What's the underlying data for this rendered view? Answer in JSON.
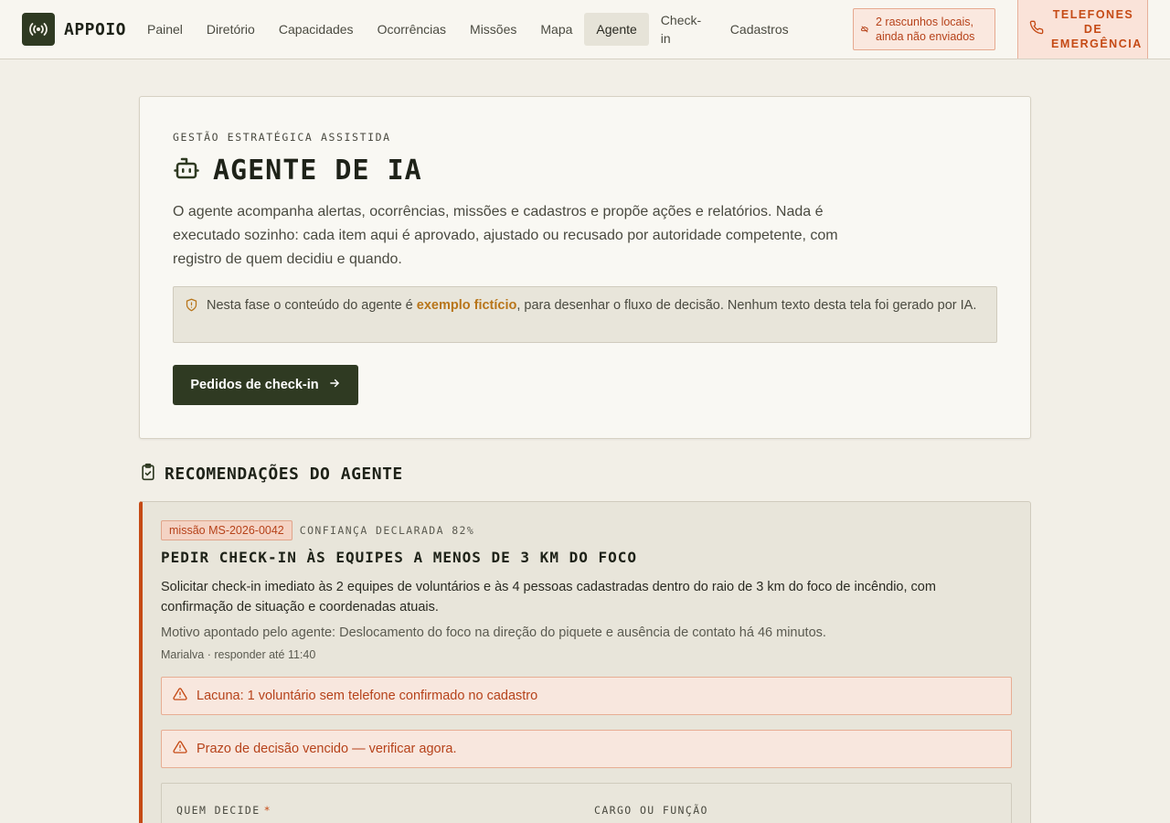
{
  "app": {
    "name": "APPOIO"
  },
  "nav": {
    "items": [
      {
        "label": "Painel"
      },
      {
        "label": "Diretório"
      },
      {
        "label": "Capacidades"
      },
      {
        "label": "Ocorrências"
      },
      {
        "label": "Missões"
      },
      {
        "label": "Mapa"
      },
      {
        "label": "Agente",
        "active": true
      },
      {
        "label": "Check-in"
      },
      {
        "label": "Cadastros"
      }
    ]
  },
  "drafts": {
    "label": "2 rascunhos locais, ainda não enviados"
  },
  "emergency": {
    "label": "TELEFONES DE EMERGÊNCIA"
  },
  "hero": {
    "eyebrow": "GESTÃO ESTRATÉGICA ASSISTIDA",
    "title": "AGENTE DE IA",
    "description": "O agente acompanha alertas, ocorrências, missões e cadastros e propõe ações e relatórios. Nada é executado sozinho: cada item aqui é aprovado, ajustado ou recusado por autoridade competente, com registro de quem decidiu e quando.",
    "notice_before": "Nesta fase o conteúdo do agente é ",
    "notice_highlight": "exemplo fictício",
    "notice_after": ", para desenhar o fluxo de decisão. Nenhum texto desta tela foi gerado por IA.",
    "primary_button": "Pedidos de check-in"
  },
  "recommendations": {
    "title": "RECOMENDAÇÕES DO AGENTE",
    "items": [
      {
        "badge": "missão MS-2026-0042",
        "confidence": "CONFIANÇA DECLARADA 82%",
        "title": "PEDIR CHECK-IN ÀS EQUIPES A MENOS DE 3 KM DO FOCO",
        "description": "Solicitar check-in imediato às 2 equipes de voluntários e às 4 pessoas cadastradas dentro do raio de 3 km do foco de incêndio, com confirmação de situação e coordenadas atuais.",
        "reason": "Motivo apontado pelo agente: Deslocamento do foco na direção do piquete e ausência de contato há 46 minutos.",
        "owner": "Marialva · responder até 11:40",
        "alerts": [
          "Lacuna: 1 voluntário sem telefone confirmado no cadastro",
          "Prazo de decisão vencido — verificar agora."
        ],
        "fields": {
          "decider_label": "QUEM DECIDE",
          "decider_required": "*",
          "role_label": "CARGO OU FUNÇÃO"
        }
      }
    ]
  },
  "colors": {
    "brand": "#2f3a22",
    "accent_warning": "#c54a15",
    "highlight": "#b8751a",
    "background": "#f2efe7"
  }
}
